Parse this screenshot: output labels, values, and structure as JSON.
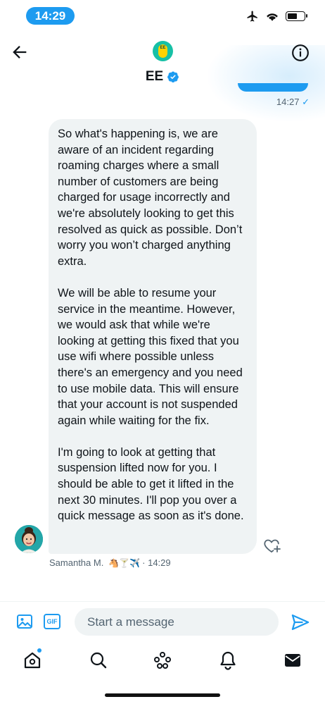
{
  "status_bar": {
    "time": "14:29"
  },
  "header": {
    "contact_name": "EE",
    "logo_text": "EE"
  },
  "sent_message": {
    "time": "14:27",
    "status_tick": "✓"
  },
  "received_message": {
    "paragraphs": [
      "So what's happening is, we are aware of an incident regarding roaming charges where a small number of customers are being charged for usage incorrectly and we're absolutely looking to get this resolved as quick as possible. Don’t worry you won’t charged anything extra.",
      "We will be able to resume your service in the meantime. However, we would ask that while we're looking at getting this fixed that you use wifi where possible unless there's an emergency and you need to use mobile data. This will ensure that your account is not suspended again while waiting for the fix.",
      "I'm going to look at getting that suspension lifted now for you. I should be able to get it lifted in the next 30 minutes. I'll pop you over a quick message as soon as it's done."
    ],
    "sender": "Samantha M.",
    "sender_emojis": "🐴🍸✈️",
    "time": "· 14:29"
  },
  "composer": {
    "placeholder": "Start a message",
    "gif_label": "GIF"
  },
  "colors": {
    "accent": "#1d9bf0",
    "bubble": "#eff3f4",
    "text": "#0f1419",
    "muted": "#536471",
    "ee_teal": "#17c0a6",
    "ee_yellow": "#ffd200"
  },
  "icons": [
    "back-arrow-icon",
    "ee-logo-icon",
    "verified-badge-icon",
    "info-icon",
    "heart-plus-icon",
    "image-icon",
    "gif-icon",
    "send-icon",
    "home-icon",
    "search-icon",
    "spaces-icon",
    "notifications-icon",
    "messages-icon"
  ]
}
